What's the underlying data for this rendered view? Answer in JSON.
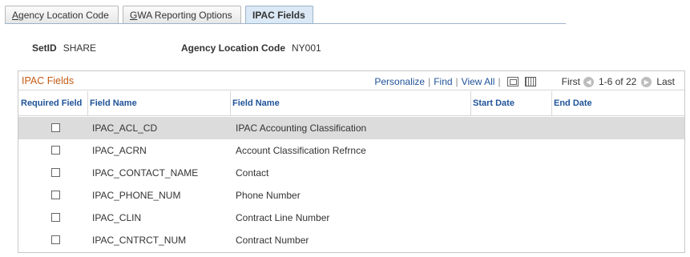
{
  "tabs": [
    {
      "label": "Agency Location Code",
      "underline": "A",
      "rest": "gency Location Code",
      "active": false
    },
    {
      "label": "GWA Reporting Options",
      "underline": "G",
      "rest": "WA Reporting Options",
      "active": false
    },
    {
      "label": "IPAC Fields",
      "active": true
    }
  ],
  "header": {
    "setid_label": "SetID",
    "setid_value": "SHARE",
    "alc_label": "Agency Location Code",
    "alc_value": "NY001"
  },
  "grid": {
    "title": "IPAC Fields",
    "nav": {
      "personalize": "Personalize",
      "find": "Find",
      "view_all": "View All",
      "first": "First",
      "count": "1-6 of 22",
      "last": "Last"
    },
    "columns": {
      "required": "Required Field",
      "field_name": "Field Name",
      "field_desc": "Field Name",
      "start_date": "Start Date",
      "end_date": "End Date"
    },
    "rows": [
      {
        "field": "IPAC_ACL_CD",
        "desc": "IPAC Accounting Classification",
        "checked": false,
        "highlighted": true
      },
      {
        "field": "IPAC_ACRN",
        "desc": "Account Classification Refrnce",
        "checked": false
      },
      {
        "field": "IPAC_CONTACT_NAME",
        "desc": "Contact",
        "checked": false
      },
      {
        "field": "IPAC_PHONE_NUM",
        "desc": "Phone Number",
        "checked": false
      },
      {
        "field": "IPAC_CLIN",
        "desc": "Contract Line Number",
        "checked": false
      },
      {
        "field": "IPAC_CNTRCT_NUM",
        "desc": "Contract Number",
        "checked": false
      }
    ]
  },
  "colors": {
    "title": "#c45c16",
    "link": "#1f5398",
    "highlight": "#dcdcdc"
  }
}
